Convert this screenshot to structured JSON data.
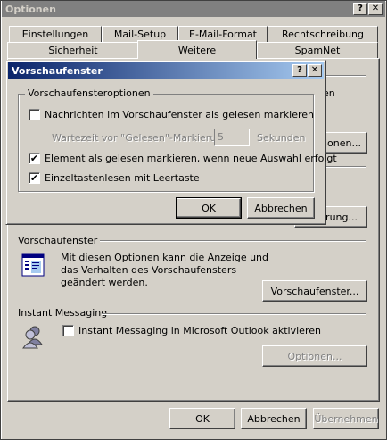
{
  "main_window": {
    "title": "Optionen",
    "help_label": "?",
    "close_label": "✕"
  },
  "tabs": {
    "row1": [
      "Einstellungen",
      "Mail-Setup",
      "E-Mail-Format",
      "Rechtschreibung"
    ],
    "row2": [
      "Sicherheit",
      "Weitere",
      "SpamNet"
    ],
    "active": "Weitere"
  },
  "partial": {
    "text_right": "en",
    "button1": "tionen...",
    "button2": "rung..."
  },
  "vorschau_section": {
    "heading": "Vorschaufenster",
    "description_line1": "Mit diesen Optionen kann die Anzeige und",
    "description_line2": "das Verhalten des Vorschaufensters",
    "description_line3": "geändert werden.",
    "button": "Vorschaufenster..."
  },
  "im_section": {
    "heading": "Instant Messaging",
    "checkbox_label": "Instant Messaging in Microsoft Outlook aktivieren",
    "checkbox_checked": false,
    "options_button": "Optionen..."
  },
  "footer_buttons": {
    "ok": "OK",
    "cancel": "Abbrechen",
    "apply": "Übernehmen"
  },
  "dialog": {
    "title": "Vorschaufenster",
    "help_label": "?",
    "close_label": "✕",
    "group_title": "Vorschaufensteroptionen",
    "opt1_label": "Nachrichten im Vorschaufenster als gelesen markieren",
    "opt1_checked": false,
    "wait_label": "Wartezeit vor \"Gelesen\"-Markierung:",
    "wait_value": "5",
    "wait_unit": "Sekunden",
    "opt2_label": "Element als gelesen markieren, wenn neue Auswahl erfolgt",
    "opt2_checked": true,
    "opt3_label": "Einzeltastenlesen mit Leertaste",
    "opt3_checked": true,
    "ok": "OK",
    "cancel": "Abbrechen"
  },
  "colors": {
    "inactive_title": "#808080",
    "active_title_start": "#0a246a",
    "active_title_end": "#a6caf0"
  }
}
